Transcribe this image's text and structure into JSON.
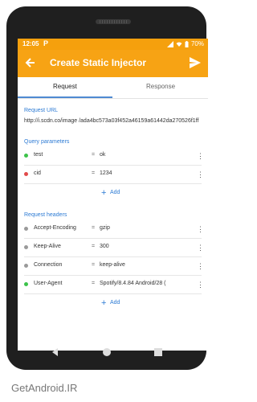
{
  "status": {
    "time": "12:05",
    "battery": "70%"
  },
  "appbar": {
    "title": "Create Static Injector"
  },
  "tabs": [
    {
      "label": "Request"
    },
    {
      "label": "Response"
    }
  ],
  "request": {
    "url_label": "Request URL",
    "url": "http://i.scdn.co/image /ada4bc573a03f452a46159a61442da270526f1ff",
    "query_label": "Query parameters",
    "query": [
      {
        "key": "test",
        "value": "ok",
        "status_color": "#3cc34a"
      },
      {
        "key": "cid",
        "value": "1234",
        "status_color": "#e14b4b"
      }
    ],
    "query_add_label": "Add",
    "headers_label": "Request headers",
    "headers": [
      {
        "key": "Accept-Encoding",
        "value": "gzip",
        "status_color": "#9a9a9a"
      },
      {
        "key": "Keep-Alive",
        "value": "300",
        "status_color": "#9a9a9a"
      },
      {
        "key": "Connection",
        "value": "keep-alive",
        "status_color": "#9a9a9a"
      },
      {
        "key": "User-Agent",
        "value": "Spotify/8.4.84 Android/28 (",
        "status_color": "#3cc34a"
      }
    ],
    "headers_add_label": "Add"
  },
  "watermark": "GetAndroid.IR",
  "colors": {
    "primary": "#f7a314",
    "statusbar": "#f5a00d",
    "accent": "#2d7bd4"
  },
  "icons": [
    "back-arrow-icon",
    "send-icon",
    "more-vert-icon",
    "add-icon",
    "nav-back-icon",
    "nav-home-icon",
    "nav-recents-icon",
    "battery-icon",
    "wifi-icon",
    "signal-icon"
  ]
}
